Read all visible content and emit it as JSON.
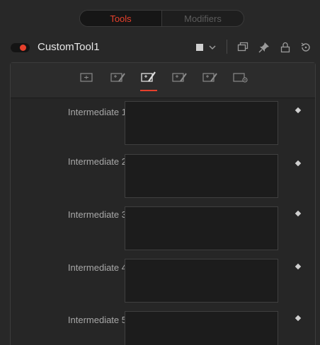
{
  "tabs": {
    "tools": "Tools",
    "modifiers": "Modifiers"
  },
  "tool": {
    "name": "CustomTool1"
  },
  "colors": {
    "accent": "#e6402c",
    "swatch": "#d0d0d0"
  },
  "header_icons": [
    "color-swatch",
    "chevron-down-icon",
    "window-icon",
    "pin-icon",
    "lock-icon",
    "reset-icon"
  ],
  "panel_tabs": [
    "controls-tab",
    "intermediate-tab",
    "setup-tab",
    "channels-tab",
    "image-tab",
    "settings-tab"
  ],
  "fields": [
    {
      "label": "Intermediate 1",
      "value": ""
    },
    {
      "label": "Intermediate 2",
      "value": ""
    },
    {
      "label": "Intermediate 3",
      "value": ""
    },
    {
      "label": "Intermediate 4",
      "value": ""
    },
    {
      "label": "Intermediate 5",
      "value": ""
    }
  ]
}
